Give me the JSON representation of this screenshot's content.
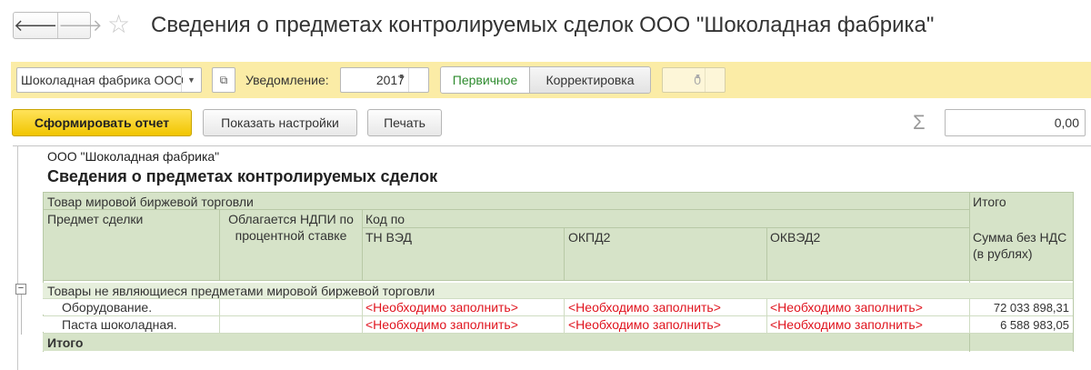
{
  "window": {
    "title": "Сведения о предметах контролируемых сделок ООО \"Шоколадная фабрика\"",
    "nav_back": "🡐",
    "nav_forward": "🡒",
    "favorite_icon": "star-icon"
  },
  "params": {
    "organization": "Шоколадная фабрика ООО",
    "notification_label": "Уведомление:",
    "year": "2017",
    "type_primary": "Первичное",
    "type_correction": "Корректировка",
    "correction_number": "0"
  },
  "commands": {
    "generate": "Сформировать отчет",
    "show_settings": "Показать настройки",
    "print": "Печать",
    "sum_value": "0,00"
  },
  "report": {
    "org_name": "ООО \"Шоколадная фабрика\"",
    "title": "Сведения о предметах контролируемых сделок",
    "header": {
      "group_title": "Товар мировой биржевой торговли",
      "total_title": "Итого",
      "subject": "Предмет сделки",
      "ndpi": "Облагается НДПИ по процентной ставке",
      "code_by": "Код по",
      "tn_ved": "ТН ВЭД",
      "okpd2": "ОКПД2",
      "okved2": "ОКВЭД2",
      "sum_no_vat": "Сумма без НДС (в рублях)"
    },
    "group_row": "Товары не являющиеся предметами мировой биржевой торговли",
    "rows": [
      {
        "subject": "Оборудование.",
        "tn_ved": "<Необходимо заполнить>",
        "okpd2": "<Необходимо заполнить>",
        "okved2": "<Необходимо заполнить>",
        "sum": "72 033 898,31"
      },
      {
        "subject": "Паста шоколадная.",
        "tn_ved": "<Необходимо заполнить>",
        "okpd2": "<Необходимо заполнить>",
        "okved2": "<Необходимо заполнить>",
        "sum": "6 588 983,05"
      }
    ],
    "total_label": "Итого"
  }
}
